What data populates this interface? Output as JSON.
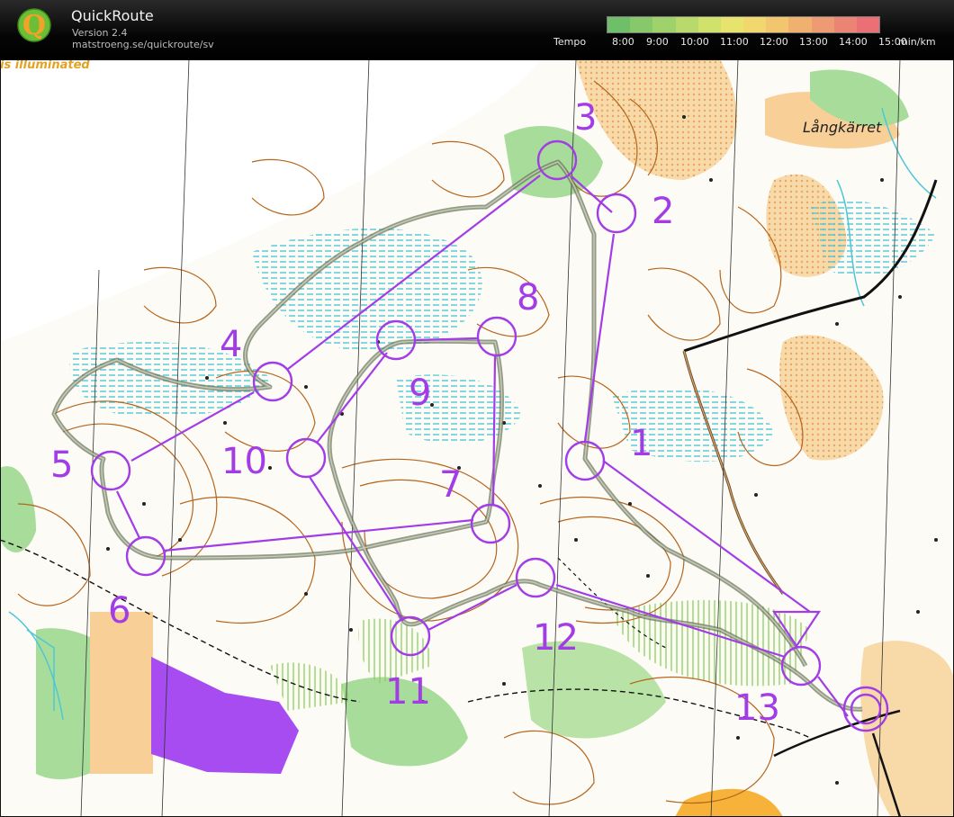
{
  "app": {
    "name": "QuickRoute",
    "version": "Version 2.4",
    "url": "matstroeng.se/quickroute/sv",
    "logo_letter": "Q"
  },
  "tempo": {
    "label": "Tempo",
    "ticks": [
      "8:00",
      "9:00",
      "10:00",
      "11:00",
      "12:00",
      "13:00",
      "14:00",
      "15:00"
    ],
    "unit": "min/km",
    "gradient": [
      "#6fbf6a",
      "#86c86a",
      "#9fd26a",
      "#b8da6b",
      "#d0e26c",
      "#e6e46d",
      "#f0d86e",
      "#f2c66f",
      "#f0b070",
      "#ee9a72",
      "#ec8474",
      "#ea7076"
    ]
  },
  "map": {
    "place_name": "Långkärret",
    "faded_text": "is illuminated",
    "controls": [
      {
        "label": "1",
        "num": 1
      },
      {
        "label": "2",
        "num": 2
      },
      {
        "label": "3",
        "num": 3
      },
      {
        "label": "4",
        "num": 4
      },
      {
        "label": "5",
        "num": 5
      },
      {
        "label": "6",
        "num": 6
      },
      {
        "label": "7",
        "num": 7
      },
      {
        "label": "8",
        "num": 8
      },
      {
        "label": "9",
        "num": 9
      },
      {
        "label": "10",
        "num": 10
      },
      {
        "label": "11",
        "num": 11
      },
      {
        "label": "12",
        "num": 12
      },
      {
        "label": "13",
        "num": 13
      }
    ],
    "colors": {
      "course": "#a23ce6",
      "route": "#8e9a7a",
      "contour": "#b5651d",
      "marsh": "#4fc6d6",
      "green": "#a8dc9a",
      "open": "#f7cf97",
      "lake": "#a74cf0",
      "field": "#f7b23a"
    }
  }
}
